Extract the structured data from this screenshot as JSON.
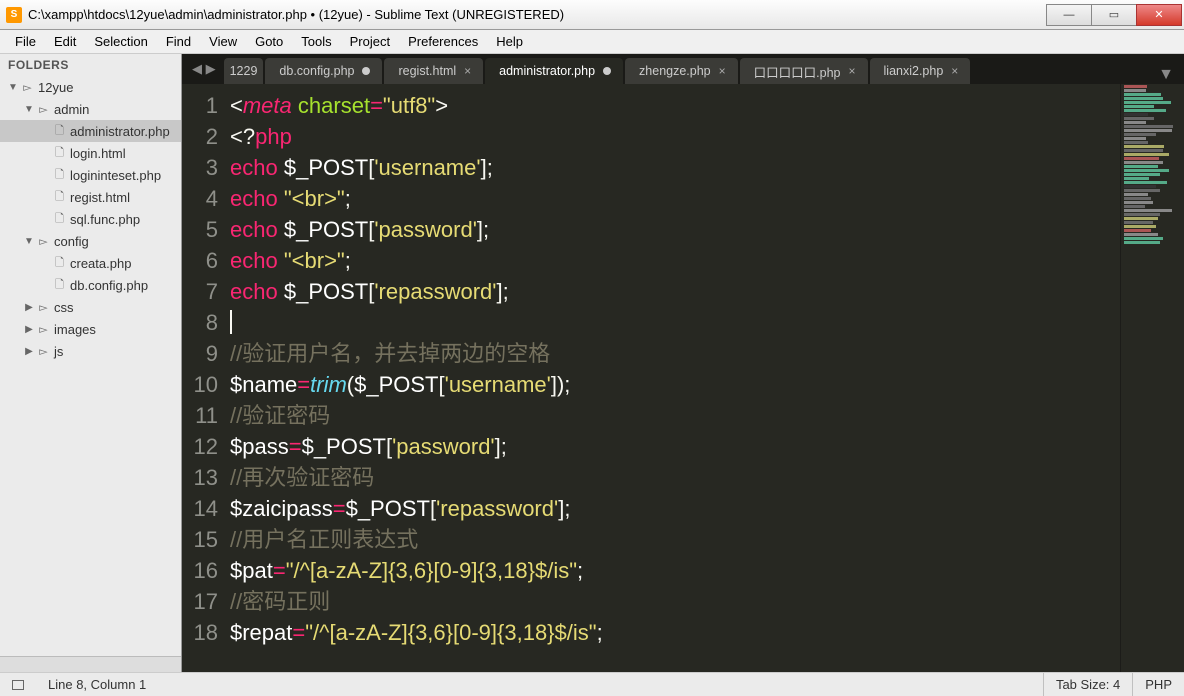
{
  "window": {
    "title": "C:\\xampp\\htdocs\\12yue\\admin\\administrator.php • (12yue) - Sublime Text (UNREGISTERED)"
  },
  "menu": [
    "File",
    "Edit",
    "Selection",
    "Find",
    "View",
    "Goto",
    "Tools",
    "Project",
    "Preferences",
    "Help"
  ],
  "sidebar": {
    "header": "FOLDERS",
    "tree": [
      {
        "depth": 0,
        "arrow": "▼",
        "icon": "▻",
        "label": "12yue",
        "folder": true
      },
      {
        "depth": 1,
        "arrow": "▼",
        "icon": "▻",
        "label": "admin",
        "folder": true
      },
      {
        "depth": 2,
        "arrow": "",
        "icon": "🗋",
        "label": "administrator.php",
        "active": true
      },
      {
        "depth": 2,
        "arrow": "",
        "icon": "🗋",
        "label": "login.html"
      },
      {
        "depth": 2,
        "arrow": "",
        "icon": "🗋",
        "label": "logininteset.php"
      },
      {
        "depth": 2,
        "arrow": "",
        "icon": "🗋",
        "label": "regist.html"
      },
      {
        "depth": 2,
        "arrow": "",
        "icon": "🗋",
        "label": "sql.func.php"
      },
      {
        "depth": 1,
        "arrow": "▼",
        "icon": "▻",
        "label": "config",
        "folder": true
      },
      {
        "depth": 2,
        "arrow": "",
        "icon": "🗋",
        "label": "creata.php"
      },
      {
        "depth": 2,
        "arrow": "",
        "icon": "🗋",
        "label": "db.config.php"
      },
      {
        "depth": 1,
        "arrow": "▶",
        "icon": "🗀",
        "label": "css",
        "folder": true
      },
      {
        "depth": 1,
        "arrow": "▶",
        "icon": "🗀",
        "label": "images",
        "folder": true
      },
      {
        "depth": 1,
        "arrow": "▶",
        "icon": "🗀",
        "label": "js",
        "folder": true
      }
    ]
  },
  "tabs": [
    {
      "label": "1229",
      "dirty": false,
      "trim": true
    },
    {
      "label": "db.config.php",
      "dirty": true
    },
    {
      "label": "regist.html",
      "close": true
    },
    {
      "label": "administrator.php",
      "dirty": true,
      "active": true
    },
    {
      "label": "zhengze.php",
      "close": true
    },
    {
      "label": "口口口口口.php",
      "close": true
    },
    {
      "label": "lianxi2.php",
      "close": true
    }
  ],
  "code_lines": [
    1,
    2,
    3,
    4,
    5,
    6,
    7,
    8,
    9,
    10,
    11,
    12,
    13,
    14,
    15,
    16,
    17,
    18
  ],
  "status": {
    "cursor": "Line 8, Column 1",
    "tabsize": "Tab Size: 4",
    "syntax": "PHP"
  }
}
